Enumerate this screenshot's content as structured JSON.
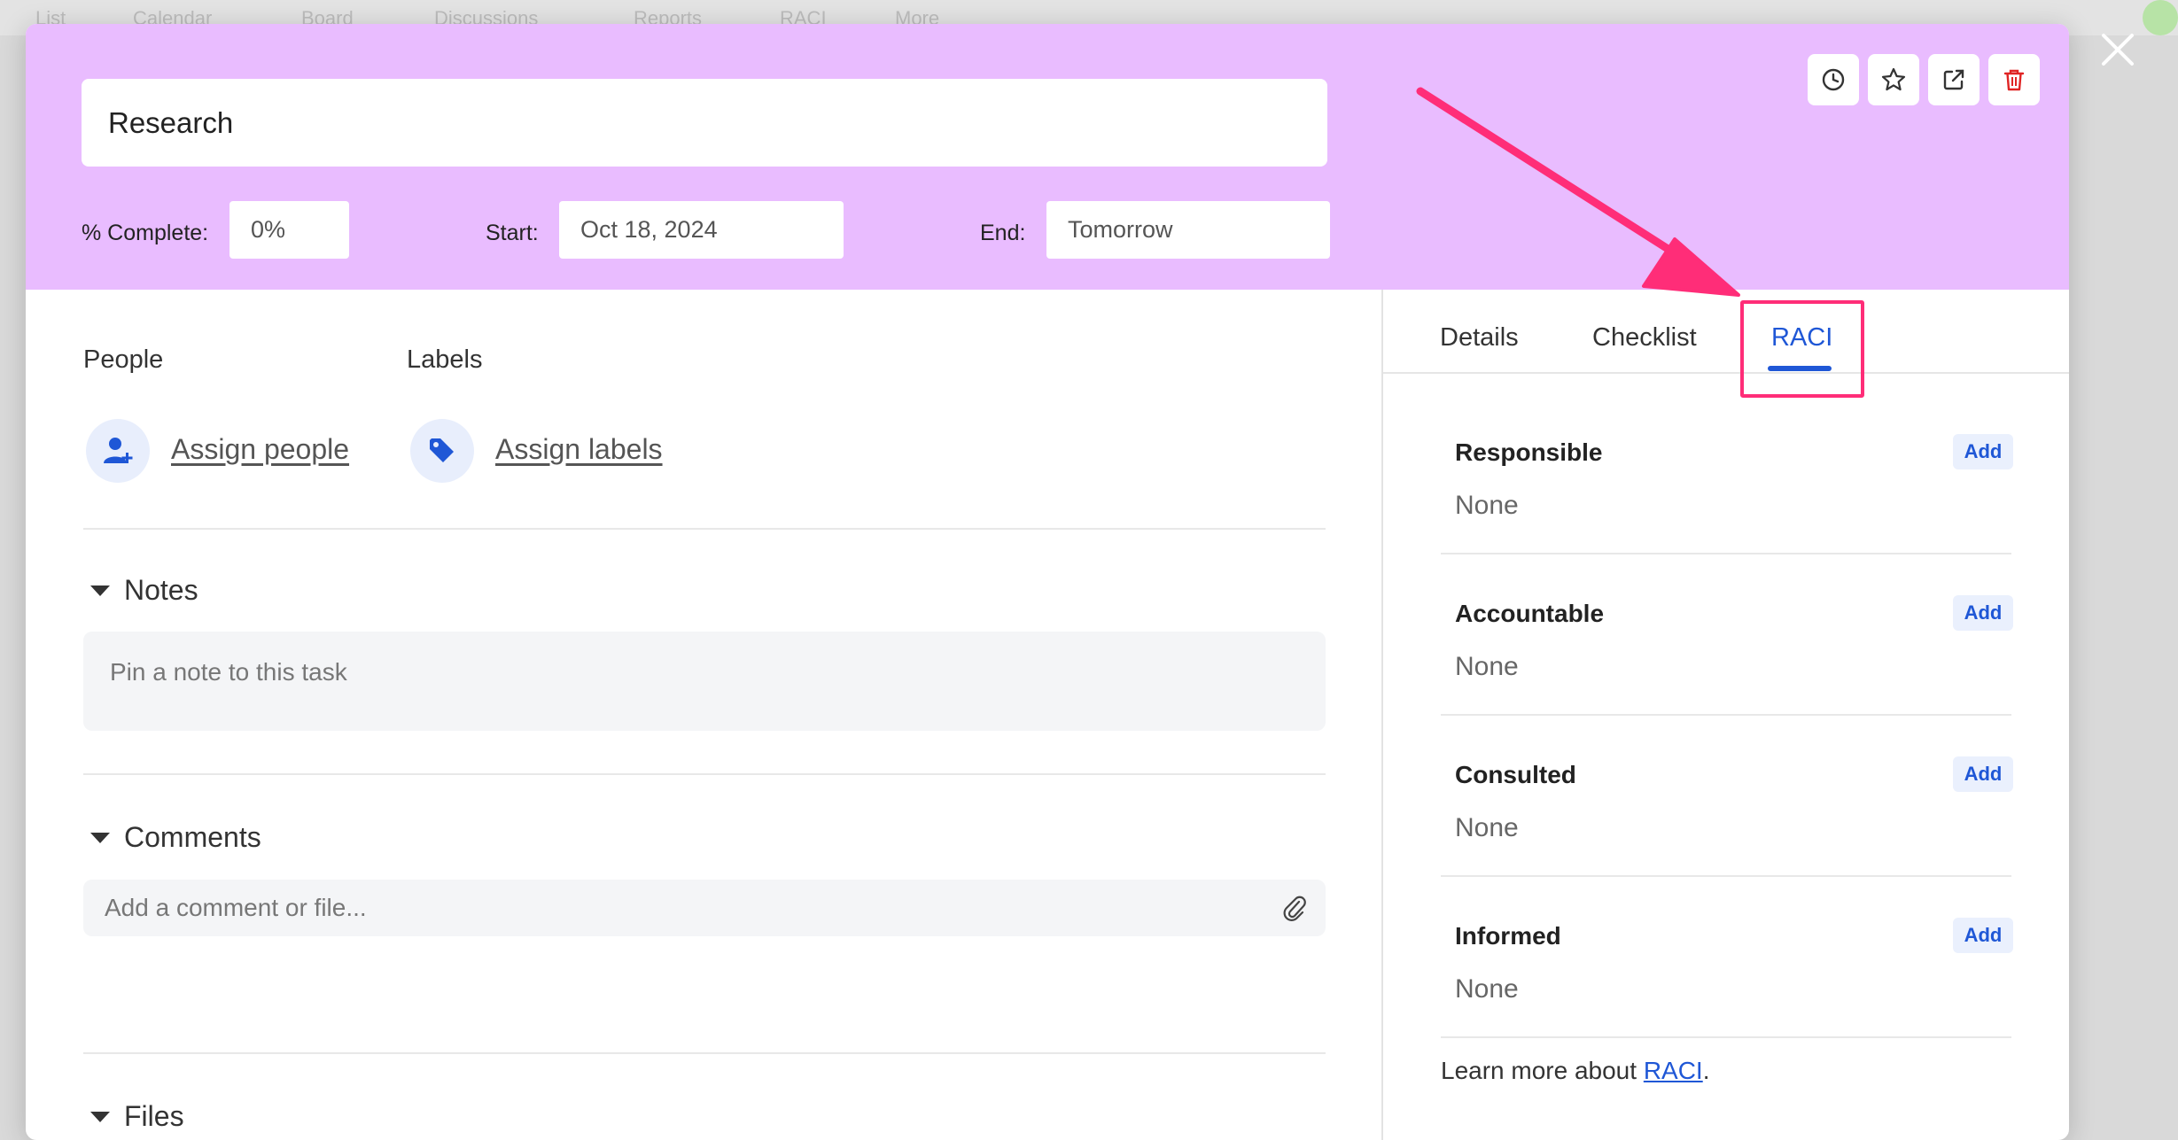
{
  "background_nav": [
    "List",
    "Calendar",
    "Board",
    "Discussions",
    "Reports",
    "RACI",
    "More"
  ],
  "header": {
    "title_value": "Research",
    "percent_label": "% Complete:",
    "percent_value": "0%",
    "start_label": "Start:",
    "start_value": "Oct 18, 2024",
    "end_label": "End:",
    "end_value": "Tomorrow",
    "background_color": "#e9bcff"
  },
  "people": {
    "label": "People",
    "link": "Assign people"
  },
  "labels": {
    "label": "Labels",
    "link": "Assign labels"
  },
  "notes": {
    "heading": "Notes",
    "placeholder": "Pin a note to this task"
  },
  "comments": {
    "heading": "Comments",
    "placeholder": "Add a comment or file..."
  },
  "files": {
    "heading": "Files"
  },
  "tabs": [
    {
      "label": "Details",
      "active": false
    },
    {
      "label": "Checklist",
      "active": false
    },
    {
      "label": "RACI",
      "active": true
    }
  ],
  "raci": [
    {
      "title": "Responsible",
      "value": "None",
      "add": "Add"
    },
    {
      "title": "Accountable",
      "value": "None",
      "add": "Add"
    },
    {
      "title": "Consulted",
      "value": "None",
      "add": "Add"
    },
    {
      "title": "Informed",
      "value": "None",
      "add": "Add"
    }
  ],
  "learn_more": {
    "prefix": "Learn more about ",
    "link": "RACI",
    "suffix": "."
  },
  "colors": {
    "accent": "#1f57d6",
    "annotation": "#ff2d78",
    "delete": "#e02424"
  }
}
